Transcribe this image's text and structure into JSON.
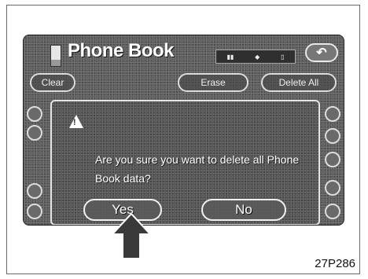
{
  "screen": {
    "title": "Phone Book",
    "status_icons": [
      "signal-icon",
      "roaming-icon",
      "battery-icon"
    ],
    "back_icon": "back-arrow-icon",
    "tabs": [
      "Clear",
      "Erase",
      "Delete All"
    ]
  },
  "dialog": {
    "icon": "warning-icon",
    "message": "Are you sure you want to delete all Phone Book data?",
    "yes_label": "Yes",
    "no_label": "No"
  },
  "pointer": {
    "icon": "pointing-arrow-icon"
  },
  "figure_code": "27P286",
  "colors": {
    "screen_bg": "#5d5d5d",
    "text": "#ffffff",
    "button_border": "#f0f0f0"
  }
}
